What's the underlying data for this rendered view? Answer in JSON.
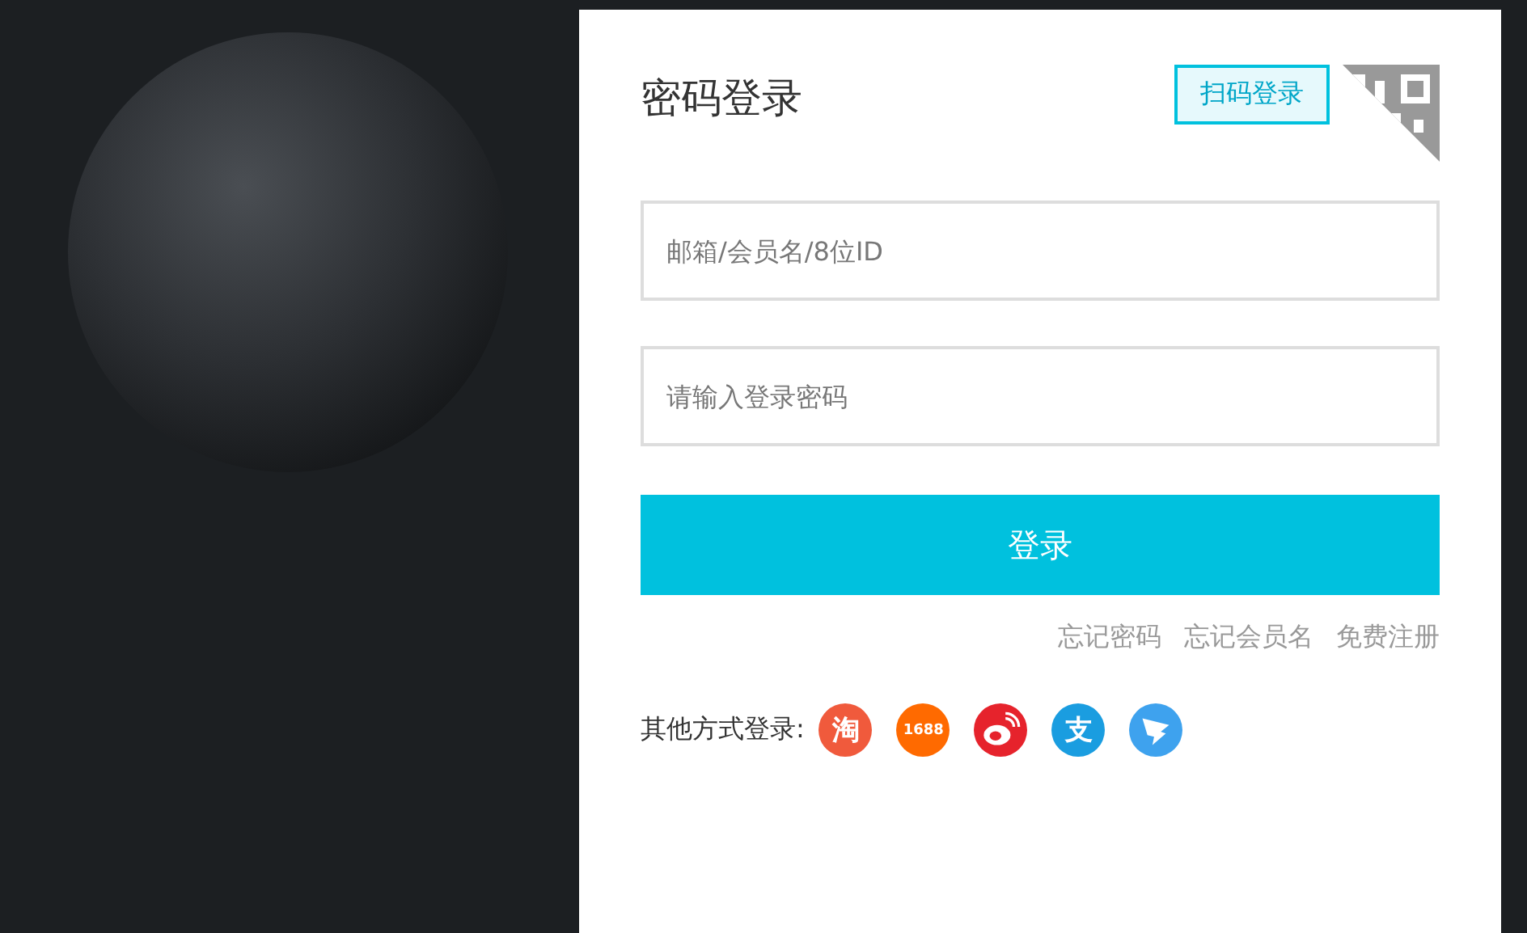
{
  "login": {
    "title": "密码登录",
    "qr_tooltip": "扫码登录",
    "username": {
      "placeholder": "邮箱/会员名/8位ID"
    },
    "password": {
      "placeholder": "请输入登录密码"
    },
    "submit": "登录",
    "links": [
      "忘记密码",
      "忘记会员名",
      "免费注册"
    ],
    "other_label": "其他方式登录:",
    "providers": [
      {
        "kind": "glyph",
        "label": "淘",
        "color": "#f05a3c"
      },
      {
        "kind": "glyph",
        "label": "1688",
        "color": "#ff6a00"
      },
      {
        "kind": "weibo",
        "color": "#e6232c"
      },
      {
        "kind": "glyph",
        "label": "支",
        "color": "#1a9de0"
      },
      {
        "kind": "wing",
        "color": "#3ea2ee"
      }
    ]
  }
}
